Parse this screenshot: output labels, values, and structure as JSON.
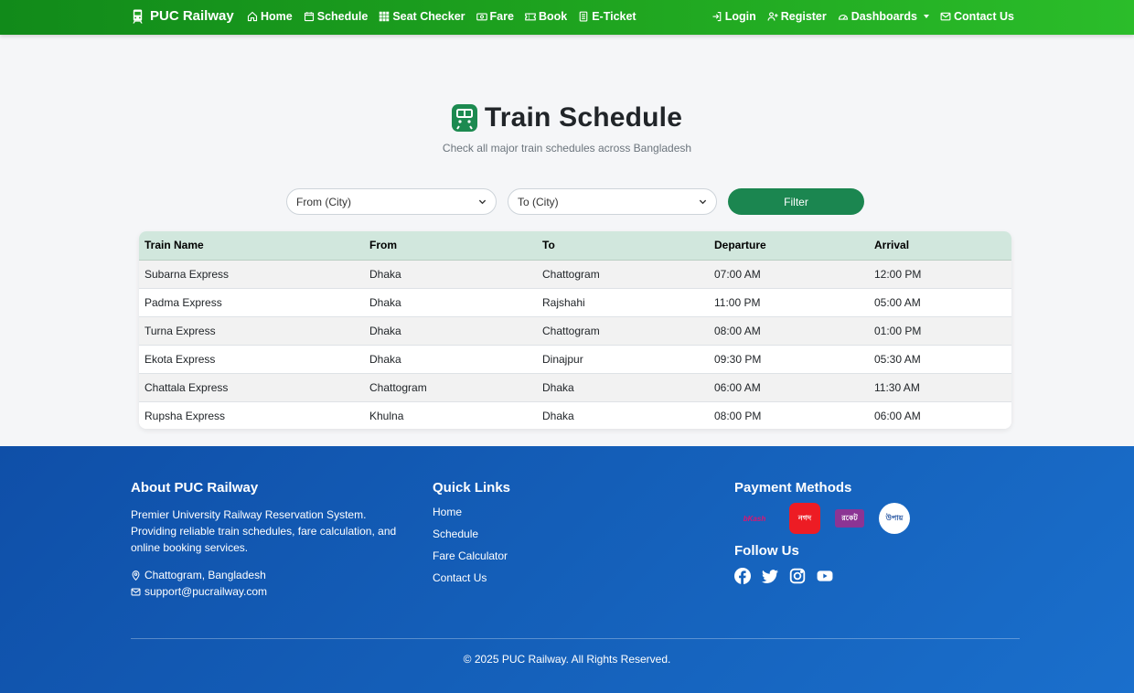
{
  "navbar": {
    "brand": "PUC Railway",
    "left_items": [
      {
        "label": "Home",
        "icon": "home-icon"
      },
      {
        "label": "Schedule",
        "icon": "calendar-icon"
      },
      {
        "label": "Seat Checker",
        "icon": "grid-icon"
      },
      {
        "label": "Fare",
        "icon": "cash-icon"
      },
      {
        "label": "Book",
        "icon": "ticket-icon"
      },
      {
        "label": "E-Ticket",
        "icon": "receipt-icon"
      }
    ],
    "right_items": [
      {
        "label": "Login",
        "icon": "login-icon"
      },
      {
        "label": "Register",
        "icon": "person-plus-icon"
      },
      {
        "label": "Dashboards",
        "icon": "speedometer-icon"
      },
      {
        "label": "Contact Us",
        "icon": "envelope-icon"
      }
    ]
  },
  "header": {
    "title": "Train Schedule",
    "subtitle": "Check all major train schedules across Bangladesh"
  },
  "filters": {
    "from_placeholder": "From (City)",
    "to_placeholder": "To (City)",
    "button_label": "Filter"
  },
  "table": {
    "headers": [
      "Train Name",
      "From",
      "To",
      "Departure",
      "Arrival"
    ],
    "rows": [
      [
        "Subarna Express",
        "Dhaka",
        "Chattogram",
        "07:00 AM",
        "12:00 PM"
      ],
      [
        "Padma Express",
        "Dhaka",
        "Rajshahi",
        "11:00 PM",
        "05:00 AM"
      ],
      [
        "Turna Express",
        "Dhaka",
        "Chattogram",
        "08:00 AM",
        "01:00 PM"
      ],
      [
        "Ekota Express",
        "Dhaka",
        "Dinajpur",
        "09:30 PM",
        "05:30 AM"
      ],
      [
        "Chattala Express",
        "Chattogram",
        "Dhaka",
        "06:00 AM",
        "11:30 AM"
      ],
      [
        "Rupsha Express",
        "Khulna",
        "Dhaka",
        "08:00 PM",
        "06:00 AM"
      ]
    ]
  },
  "footer": {
    "about_title": "About PUC Railway",
    "about_text": "Premier University Railway Reservation System. Providing reliable train schedules, fare calculation, and online booking services.",
    "location": "Chattogram, Bangladesh",
    "email": "support@pucrailway.com",
    "quick_links_title": "Quick Links",
    "quick_links": [
      "Home",
      "Schedule",
      "Fare Calculator",
      "Contact Us"
    ],
    "payment_title": "Payment Methods",
    "payments": [
      {
        "name": "bKash",
        "label": "bKash"
      },
      {
        "name": "Nagad",
        "label": "নগদ"
      },
      {
        "name": "Rocket",
        "label": "রকেট"
      },
      {
        "name": "Upay",
        "label": "উপায়"
      }
    ],
    "follow_title": "Follow Us",
    "social": [
      "facebook-icon",
      "twitter-icon",
      "instagram-icon",
      "youtube-icon"
    ],
    "copyright": "© 2025 PUC Railway. All Rights Reserved."
  },
  "colors": {
    "navbar_start": "#118a1a",
    "navbar_end": "#2bbd2a",
    "primary_button": "#1b8650",
    "table_header": "#d1e7dd",
    "footer": "#1561bb"
  }
}
